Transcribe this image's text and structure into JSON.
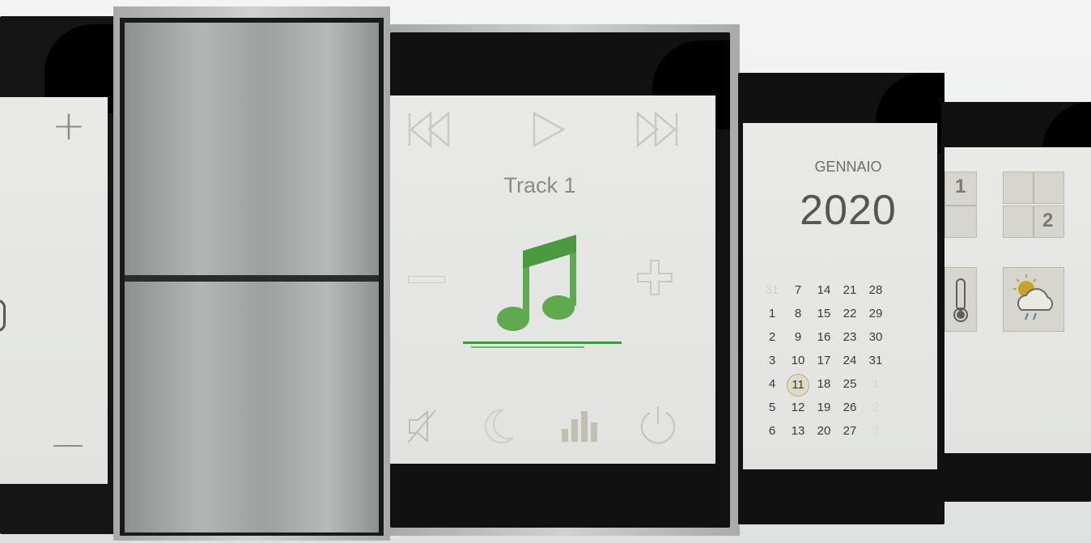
{
  "thermostat": {
    "plus_symbol": "+",
    "minus_symbol": "—"
  },
  "player": {
    "track_label": "Track 1",
    "accent_color": "#3f9a3f",
    "icons": [
      "skip-back-icon",
      "play-icon",
      "skip-forward-icon",
      "volume-down-icon",
      "music-note-icon",
      "volume-up-icon",
      "mute-icon",
      "sleep-moon-icon",
      "equalizer-icon",
      "power-icon"
    ]
  },
  "calendar": {
    "month": "GENNAIO",
    "year": "2020",
    "columns": [
      [
        "31",
        "1",
        "2",
        "3",
        "4",
        "5",
        "6"
      ],
      [
        "7",
        "8",
        "9",
        "10",
        "11",
        "12",
        "13"
      ],
      [
        "14",
        "15",
        "16",
        "17",
        "18",
        "19",
        "20"
      ],
      [
        "21",
        "22",
        "23",
        "24",
        "25",
        "26",
        "27"
      ],
      [
        "28",
        "29",
        "30",
        "31",
        "1",
        "2",
        "3"
      ]
    ],
    "selected_day": "11"
  },
  "scenes": {
    "tile_1_label": "1",
    "tile_2_label": "2",
    "icons": [
      "thermometer-icon",
      "weather-icon"
    ]
  }
}
